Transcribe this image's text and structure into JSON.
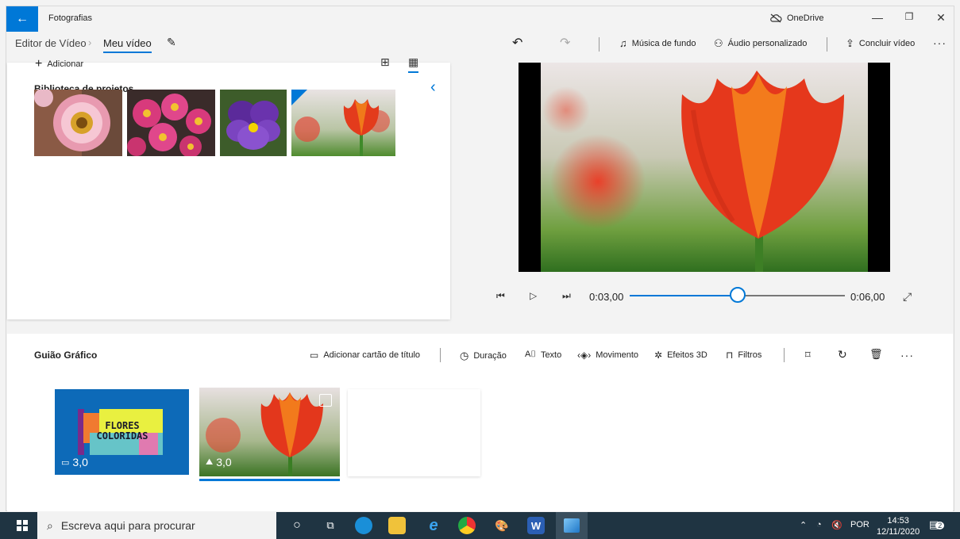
{
  "window": {
    "app_title": "Fotografias",
    "onedrive_label": "OneDrive"
  },
  "breadcrumb": {
    "parent": "Editor de Vídeo",
    "current": "Meu vídeo"
  },
  "toolbar": {
    "background_music": "Música de fundo",
    "custom_audio": "Áudio personalizado",
    "finish_video": "Concluir vídeo"
  },
  "library": {
    "title": "Biblioteca de projetos",
    "add_label": "Adicionar",
    "thumbnails": [
      "gerbera-flower",
      "pink-daisies",
      "purple-pansy",
      "orange-tulip"
    ]
  },
  "player": {
    "current_time": "0:03,00",
    "total_time": "0:06,00",
    "progress": 0.5
  },
  "storyboard": {
    "title": "Guião Gráfico",
    "add_title_card": "Adicionar cartão de título",
    "duration": "Duração",
    "text": "Texto",
    "motion": "Movimento",
    "effects_3d": "Efeitos 3D",
    "filters": "Filtros",
    "cards": [
      {
        "title_line1": "FLORES",
        "title_line2": "COLORIDAS",
        "duration": "3,0"
      },
      {
        "duration": "3,0"
      }
    ]
  },
  "taskbar": {
    "search_placeholder": "Escreva aqui para procurar",
    "language": "POR",
    "time": "14:53",
    "date": "12/11/2020",
    "notifications": "2"
  },
  "colors": {
    "accent": "#0078d7",
    "taskbar": "#1f3442",
    "title_card_bg": "#0d6ab8"
  }
}
